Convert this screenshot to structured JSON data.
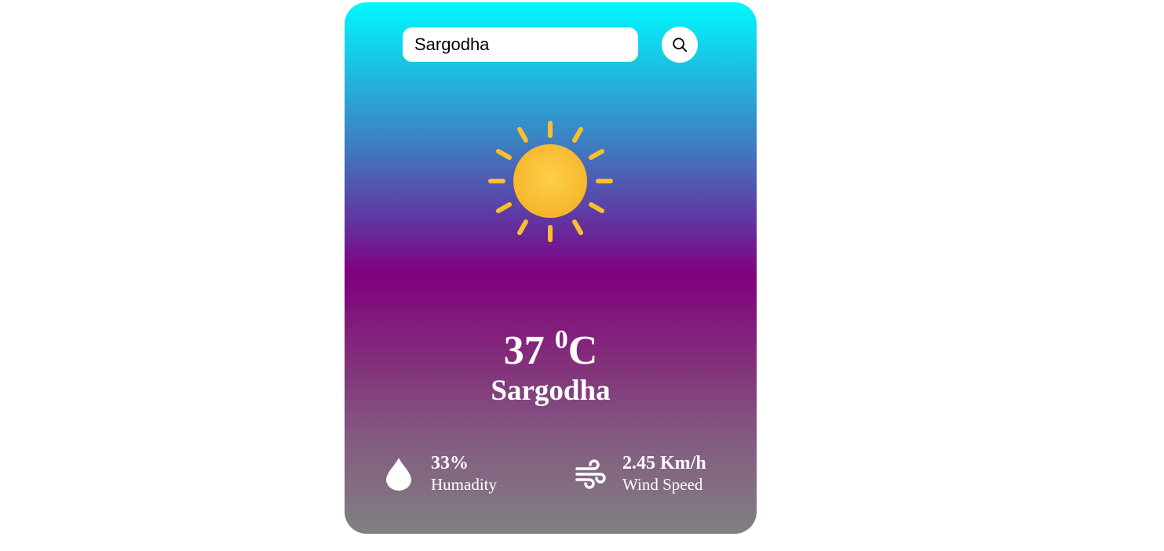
{
  "search": {
    "value": "Sargodha"
  },
  "weather": {
    "condition_icon": "sun-icon",
    "temperature_value": "37",
    "temperature_degree": "0",
    "temperature_unit": "C",
    "city": "Sargodha"
  },
  "details": {
    "humidity": {
      "icon": "water-drop-icon",
      "value": "33%",
      "label": "Humadity"
    },
    "wind": {
      "icon": "wind-icon",
      "value": "2.45 Km/h",
      "label": "Wind Speed"
    }
  },
  "colors": {
    "gradient_top": "#00f8ff",
    "gradient_middle": "#80007f",
    "gradient_bottom": "#808080",
    "sun": "#fbbf2e"
  }
}
